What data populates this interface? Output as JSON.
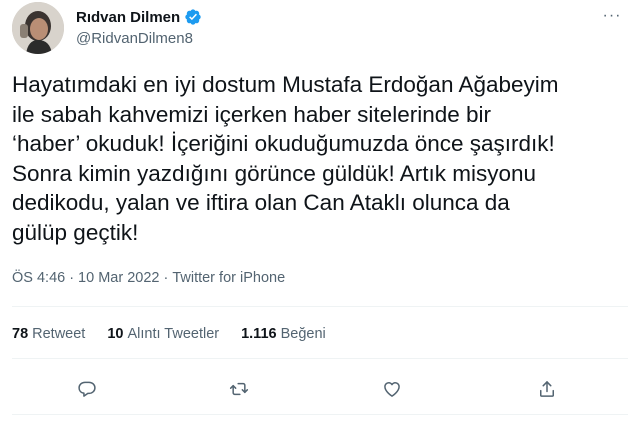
{
  "author": {
    "display_name": "Rıdvan Dilmen",
    "handle": "@RidvanDilmen8",
    "verified": true
  },
  "tweet": {
    "text": "Hayatımdaki en iyi dostum Mustafa Erdoğan Ağabeyim\nile sabah kahvemizi içerken haber sitelerinde bir\n‘haber’ okuduk! İçeriğini okuduğumuzda önce şaşırdık!\nSonra kimin yazdığını görünce güldük! Artık misyonu\ndedikodu, yalan ve iftira olan Can Ataklı olunca da\ngülüp geçtik!",
    "time": "ÖS 4:46",
    "date": "10 Mar 2022",
    "source": "Twitter for iPhone",
    "separator": "·"
  },
  "stats": {
    "retweets_count": "78",
    "retweets_label": "Retweet",
    "quotes_count": "10",
    "quotes_label": "Alıntı Tweetler",
    "likes_count": "1.116",
    "likes_label": "Beğeni"
  },
  "colors": {
    "text": "#0f1419",
    "secondary": "#536471",
    "verified": "#1d9bf0",
    "divider": "#eff3f4"
  },
  "icons": {
    "more": "more-horizontal-icon",
    "reply": "reply-icon",
    "retweet": "retweet-icon",
    "like": "heart-icon",
    "share": "share-icon"
  }
}
